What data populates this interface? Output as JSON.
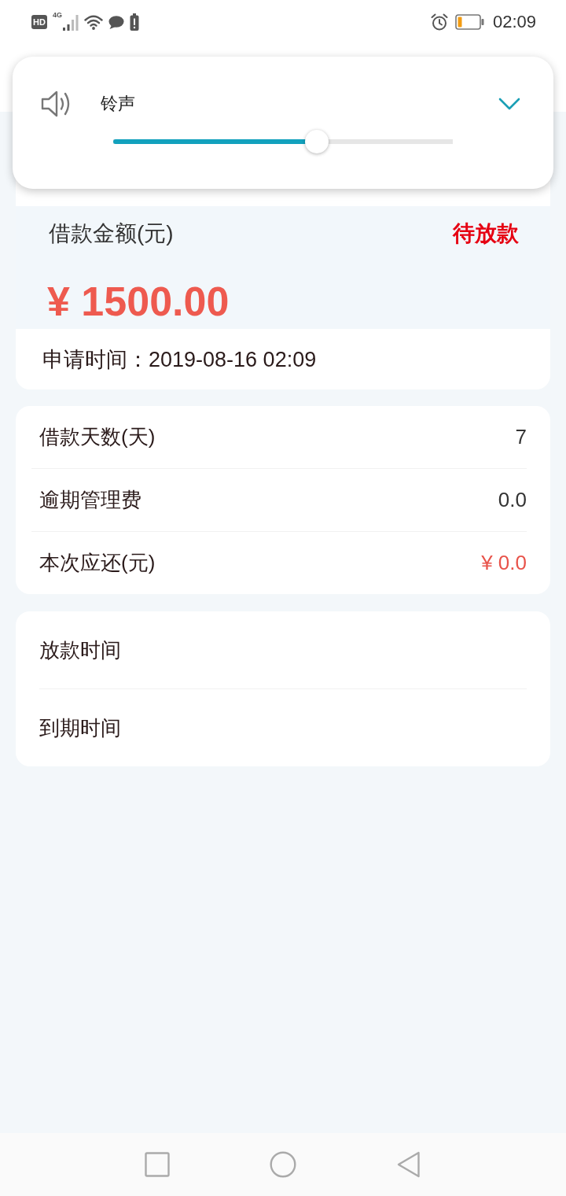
{
  "status_bar": {
    "hd": "HD",
    "network": "4G",
    "time": "02:09"
  },
  "volume_panel": {
    "label": "铃声",
    "level": 0.6
  },
  "loan_card": {
    "amount_label": "借款金额(元)",
    "status": "待放款",
    "amount": "¥ 1500.00",
    "apply_time": "申请时间：2019-08-16 02:09"
  },
  "detail_rows": [
    {
      "label": "借款天数(天)",
      "value": "7",
      "kind": "plain"
    },
    {
      "label": "逾期管理费",
      "value": "0.0",
      "kind": "plain"
    },
    {
      "label": "本次应还(元)",
      "value": "¥ 0.0",
      "kind": "highlight"
    }
  ],
  "time_rows": [
    {
      "label": "放款时间"
    },
    {
      "label": "到期时间"
    }
  ]
}
